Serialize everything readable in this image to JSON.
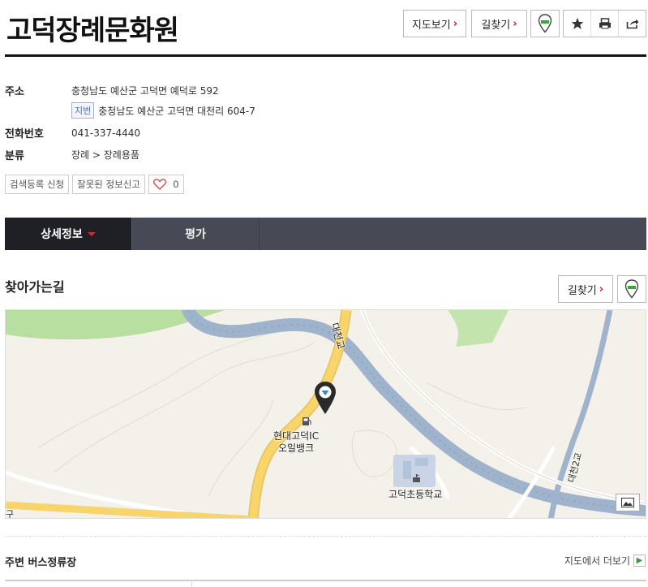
{
  "place": {
    "name": "고덕장례문화원"
  },
  "header_buttons": {
    "map_view": "지도보기",
    "directions": "길찾기",
    "chevron": "›"
  },
  "info": {
    "address_label": "주소",
    "address": "충청남도 예산군 고덕면 예덕로 592",
    "jibun_badge": "지번",
    "jibun_address": "충청남도 예산군 고덕면 대천리 604-7",
    "phone_label": "전화번호",
    "phone": "041-337-4440",
    "category_label": "분류",
    "category": "장례 > 장례용품"
  },
  "tags": {
    "register": "검색등록 신청",
    "report": "잘못된 정보신고",
    "like_count": "0"
  },
  "tabs": [
    {
      "label": "상세정보",
      "active": true
    },
    {
      "label": "평가",
      "active": false
    }
  ],
  "directions_section": {
    "title": "찾아가는길",
    "directions_button": "길찾기"
  },
  "map": {
    "labels": {
      "gas_station": "현대고덕IC",
      "gas_station_line2": "오일뱅크",
      "school": "고덕초등학교",
      "bridge1": "대천교",
      "bridge2": "대천2교",
      "edge": "구"
    },
    "colors": {
      "road_main": "#f7d56b",
      "river": "#9fb3cc",
      "greenery": "#a6d68a",
      "land": "#f3f1ea"
    }
  },
  "bus_section": {
    "title": "주변 버스정류장",
    "more_link": "지도에서 더보기"
  },
  "colors": {
    "accent_red": "#d71920",
    "tab_bg": "#474a54",
    "tab_active_bg": "#1e2026"
  }
}
